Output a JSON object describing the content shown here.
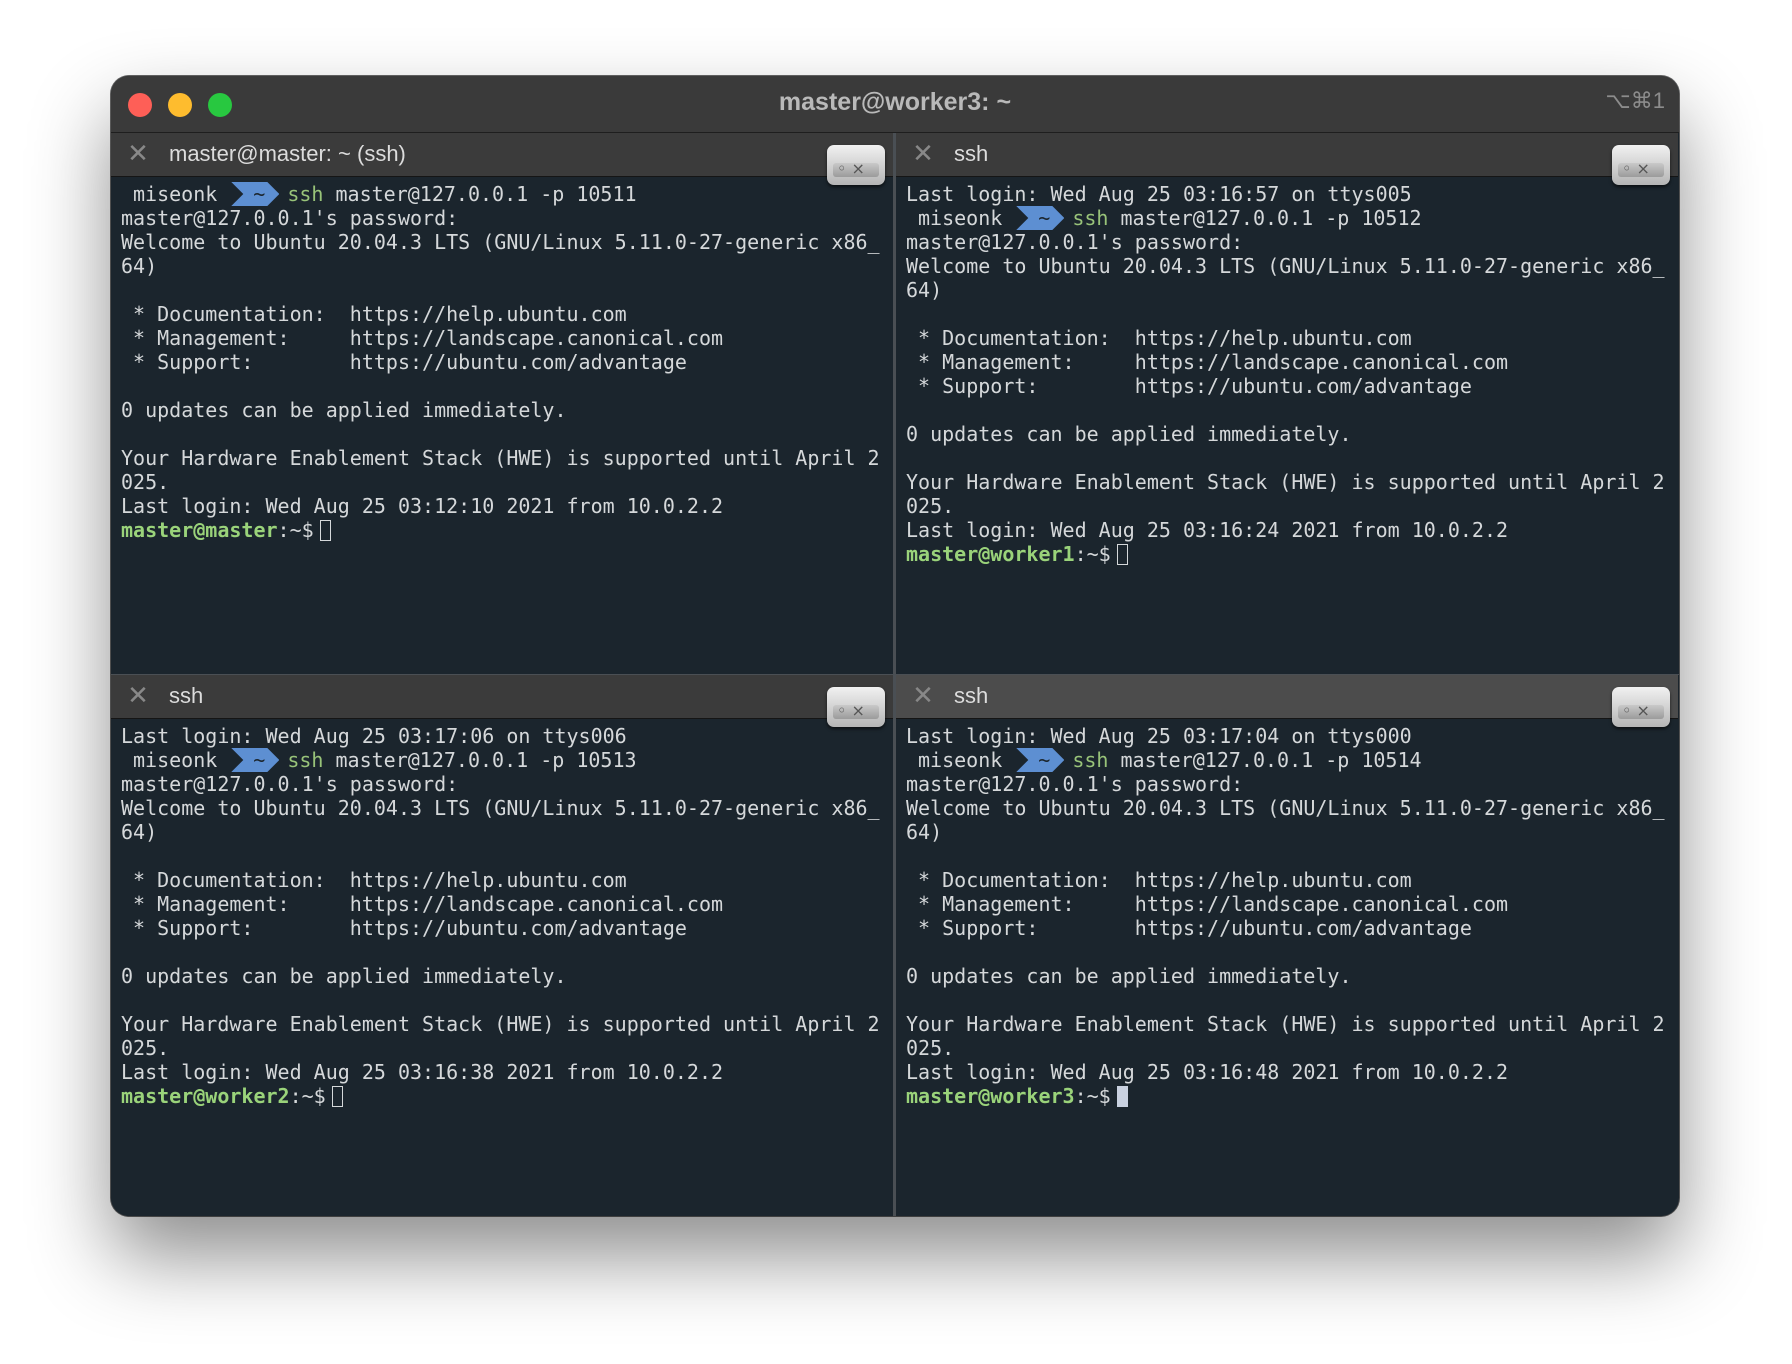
{
  "window": {
    "title": "master@worker3: ~",
    "shortcut": "⌥⌘1"
  },
  "panes": [
    {
      "tab_title": "master@master: ~ (ssh)",
      "lines": [
        {
          "type": "ps",
          "user": "miseonk",
          "dir": "~",
          "cmd": "ssh",
          "args": " master@127.0.0.1 -p 10511"
        },
        {
          "type": "text",
          "text": "master@127.0.0.1's password:"
        },
        {
          "type": "text",
          "text": "Welcome to Ubuntu 20.04.3 LTS (GNU/Linux 5.11.0-27-generic x86_"
        },
        {
          "type": "text",
          "text": "64)"
        },
        {
          "type": "text",
          "text": ""
        },
        {
          "type": "text",
          "text": " * Documentation:  https://help.ubuntu.com"
        },
        {
          "type": "text",
          "text": " * Management:     https://landscape.canonical.com"
        },
        {
          "type": "text",
          "text": " * Support:        https://ubuntu.com/advantage"
        },
        {
          "type": "text",
          "text": ""
        },
        {
          "type": "text",
          "text": "0 updates can be applied immediately."
        },
        {
          "type": "text",
          "text": ""
        },
        {
          "type": "text",
          "text": "Your Hardware Enablement Stack (HWE) is supported until April 2"
        },
        {
          "type": "text",
          "text": "025."
        },
        {
          "type": "text",
          "text": "Last login: Wed Aug 25 03:12:10 2021 from 10.0.2.2"
        },
        {
          "type": "prompt",
          "user": "master@master",
          "rest": ":~$",
          "cursor": "hollow"
        }
      ]
    },
    {
      "tab_title": "ssh",
      "lines": [
        {
          "type": "text",
          "text": "Last login: Wed Aug 25 03:16:57 on ttys005"
        },
        {
          "type": "ps",
          "user": "miseonk",
          "dir": "~",
          "cmd": "ssh",
          "args": " master@127.0.0.1 -p 10512"
        },
        {
          "type": "text",
          "text": "master@127.0.0.1's password:"
        },
        {
          "type": "text",
          "text": "Welcome to Ubuntu 20.04.3 LTS (GNU/Linux 5.11.0-27-generic x86_"
        },
        {
          "type": "text",
          "text": "64)"
        },
        {
          "type": "text",
          "text": ""
        },
        {
          "type": "text",
          "text": " * Documentation:  https://help.ubuntu.com"
        },
        {
          "type": "text",
          "text": " * Management:     https://landscape.canonical.com"
        },
        {
          "type": "text",
          "text": " * Support:        https://ubuntu.com/advantage"
        },
        {
          "type": "text",
          "text": ""
        },
        {
          "type": "text",
          "text": "0 updates can be applied immediately."
        },
        {
          "type": "text",
          "text": ""
        },
        {
          "type": "text",
          "text": "Your Hardware Enablement Stack (HWE) is supported until April 2"
        },
        {
          "type": "text",
          "text": "025."
        },
        {
          "type": "text",
          "text": "Last login: Wed Aug 25 03:16:24 2021 from 10.0.2.2"
        },
        {
          "type": "prompt",
          "user": "master@worker1",
          "rest": ":~$",
          "cursor": "hollow"
        }
      ]
    },
    {
      "tab_title": "ssh",
      "lines": [
        {
          "type": "text",
          "text": "Last login: Wed Aug 25 03:17:06 on ttys006"
        },
        {
          "type": "ps",
          "user": "miseonk",
          "dir": "~",
          "cmd": "ssh",
          "args": " master@127.0.0.1 -p 10513"
        },
        {
          "type": "text",
          "text": "master@127.0.0.1's password:"
        },
        {
          "type": "text",
          "text": "Welcome to Ubuntu 20.04.3 LTS (GNU/Linux 5.11.0-27-generic x86_"
        },
        {
          "type": "text",
          "text": "64)"
        },
        {
          "type": "text",
          "text": ""
        },
        {
          "type": "text",
          "text": " * Documentation:  https://help.ubuntu.com"
        },
        {
          "type": "text",
          "text": " * Management:     https://landscape.canonical.com"
        },
        {
          "type": "text",
          "text": " * Support:        https://ubuntu.com/advantage"
        },
        {
          "type": "text",
          "text": ""
        },
        {
          "type": "text",
          "text": "0 updates can be applied immediately."
        },
        {
          "type": "text",
          "text": ""
        },
        {
          "type": "text",
          "text": "Your Hardware Enablement Stack (HWE) is supported until April 2"
        },
        {
          "type": "text",
          "text": "025."
        },
        {
          "type": "text",
          "text": "Last login: Wed Aug 25 03:16:38 2021 from 10.0.2.2"
        },
        {
          "type": "prompt",
          "user": "master@worker2",
          "rest": ":~$",
          "cursor": "hollow"
        }
      ]
    },
    {
      "tab_title": "ssh",
      "lines": [
        {
          "type": "text",
          "text": "Last login: Wed Aug 25 03:17:04 on ttys000"
        },
        {
          "type": "ps",
          "user": "miseonk",
          "dir": "~",
          "cmd": "ssh",
          "args": " master@127.0.0.1 -p 10514"
        },
        {
          "type": "text",
          "text": "master@127.0.0.1's password:"
        },
        {
          "type": "text",
          "text": "Welcome to Ubuntu 20.04.3 LTS (GNU/Linux 5.11.0-27-generic x86_"
        },
        {
          "type": "text",
          "text": "64)"
        },
        {
          "type": "text",
          "text": ""
        },
        {
          "type": "text",
          "text": " * Documentation:  https://help.ubuntu.com"
        },
        {
          "type": "text",
          "text": " * Management:     https://landscape.canonical.com"
        },
        {
          "type": "text",
          "text": " * Support:        https://ubuntu.com/advantage"
        },
        {
          "type": "text",
          "text": ""
        },
        {
          "type": "text",
          "text": "0 updates can be applied immediately."
        },
        {
          "type": "text",
          "text": ""
        },
        {
          "type": "text",
          "text": "Your Hardware Enablement Stack (HWE) is supported until April 2"
        },
        {
          "type": "text",
          "text": "025."
        },
        {
          "type": "text",
          "text": "Last login: Wed Aug 25 03:16:48 2021 from 10.0.2.2"
        },
        {
          "type": "prompt",
          "user": "master@worker3",
          "rest": ":~$",
          "cursor": "solid"
        }
      ]
    }
  ],
  "colors": {
    "background": "#1b252d",
    "prompt_user": "#9ad37a",
    "ps_dir_segment": "#5d8fd2",
    "text": "#d5d8da"
  },
  "icons": {
    "pane_badge": "hard-drive-icon",
    "tab_close": "close-icon",
    "tab_menu": "hamburger-menu-icon"
  }
}
